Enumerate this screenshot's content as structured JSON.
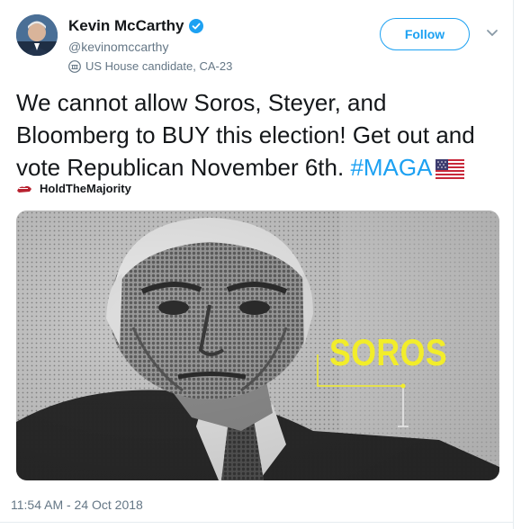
{
  "tweet": {
    "author_name": "Kevin McCarthy",
    "handle": "@kevinomccarthy",
    "label": "US House candidate, CA-23",
    "follow_label": "Follow",
    "text_main": "We cannot allow Soros, Steyer, and Bloomberg to BUY this election! Get out and vote Republican November 6th. ",
    "hashtag": "#MAGA",
    "sender": "HoldTheMajority",
    "media_label": "SOROS",
    "timestamp": "11:54 AM - 24 Oct 2018"
  },
  "colors": {
    "accent": "#1da1f2",
    "highlight": "#f2ed2a",
    "secondary_text": "#657786"
  },
  "icons": [
    "verified-icon",
    "government-label-icon",
    "chevron-down-icon",
    "us-flag-icon",
    "holdthemajority-logo-icon"
  ]
}
